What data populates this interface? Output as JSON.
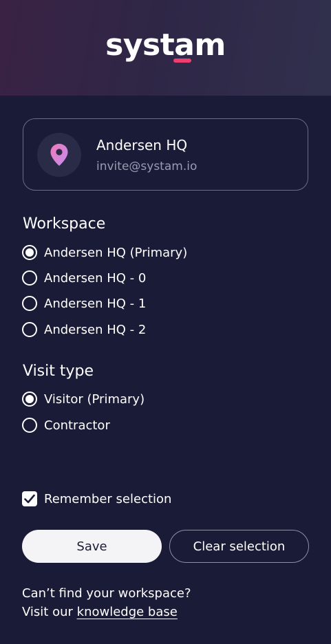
{
  "brand": {
    "logo_text": "systam",
    "accent_color": "#ec3f6f"
  },
  "location_card": {
    "icon": "map-pin-icon",
    "name": "Andersen HQ",
    "email": "invite@systam.io"
  },
  "workspace": {
    "title": "Workspace",
    "options": [
      {
        "label": "Andersen HQ (Primary)",
        "selected": true
      },
      {
        "label": "Andersen HQ - 0",
        "selected": false
      },
      {
        "label": "Andersen HQ - 1",
        "selected": false
      },
      {
        "label": "Andersen HQ - 2",
        "selected": false
      }
    ]
  },
  "visit_type": {
    "title": "Visit type",
    "options": [
      {
        "label": "Visitor (Primary)",
        "selected": true
      },
      {
        "label": "Contractor",
        "selected": false
      }
    ]
  },
  "remember": {
    "label": "Remember selection",
    "checked": true
  },
  "actions": {
    "save_label": "Save",
    "clear_label": "Clear selection"
  },
  "help": {
    "line1": "Can’t find your workspace?",
    "line2_prefix": "Visit our",
    "link_label": "knowledge base"
  }
}
